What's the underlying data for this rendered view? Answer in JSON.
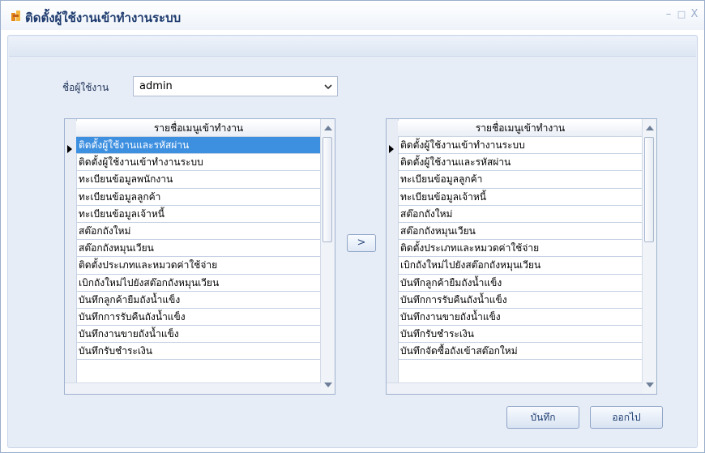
{
  "window": {
    "title": "ติดตั้งผู้ใช้งานเข้าทำงานระบบ",
    "minimize_label": "–",
    "maximize_label": "□",
    "close_label": "X",
    "icon": "app-logo-icon"
  },
  "user": {
    "label": "ชื่อผู้ใช้งาน",
    "selected": "admin"
  },
  "left_list": {
    "header": "รายชื่อเมนูเข้าทำงาน",
    "selected_index": 0,
    "items": [
      "ติดตั้งผู้ใช้งานและรหัสผ่าน",
      "ติดตั้งผู้ใช้งานเข้าทำงานระบบ",
      "ทะเบียนข้อมูลพนักงาน",
      "ทะเบียนข้อมูลลูกค้า",
      "ทะเบียนข้อมูลเจ้าหนี้",
      "สต๊อกถังใหม่",
      "สต๊อกถังหมุนเวียน",
      "ติดตั้งประเภทและหมวดค่าใช้จ่าย",
      "เบิกถังใหม่ไปยังสต๊อกถังหมุนเวียน",
      "บันทึกลูกค้ายืมถังน้ำแข็ง",
      "บันทึกการรับคืนถังน้ำแข็ง",
      "บันทึกงานขายถังน้ำแข็ง",
      "บันทึกรับชำระเงิน"
    ]
  },
  "right_list": {
    "header": "รายชื่อเมนูเข้าทำงาน",
    "items": [
      "ติดตั้งผู้ใช้งานเข้าทำงานระบบ",
      "ติดตั้งผู้ใช้งานและรหัสผ่าน",
      "ทะเบียนข้อมูลลูกค้า",
      "ทะเบียนข้อมูลเจ้าหนี้",
      "สต๊อกถังใหม่",
      "สต๊อกถังหมุนเวียน",
      "ติดตั้งประเภทและหมวดค่าใช้จ่าย",
      "เบิกถังใหม่ไปยังสต๊อกถังหมุนเวียน",
      "บันทึกลูกค้ายืมถังน้ำแข็ง",
      "บันทึกการรับคืนถังน้ำแข็ง",
      "บันทึกงานขายถังน้ำแข็ง",
      "บันทึกรับชำระเงิน",
      "บันทึกจัดซื้อถังเข้าสต๊อกใหม่"
    ]
  },
  "buttons": {
    "move": ">",
    "save": "บันทึก",
    "exit": "ออกไป"
  },
  "colors": {
    "selection": "#3d8fe0",
    "title_text": "#1e3b6e",
    "panel": "#e6edf7"
  }
}
